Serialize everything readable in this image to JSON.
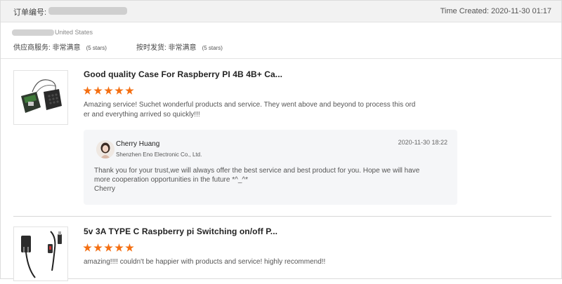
{
  "order": {
    "label": "订单编号:",
    "time_created": "Time Created: 2020-11-30 01:17"
  },
  "buyer": {
    "country": "United States",
    "ratings": [
      {
        "label": "供应商服务: 非常满意",
        "stars": "(5 stars)"
      },
      {
        "label": "按时发货: 非常满意",
        "stars": "(5 stars)"
      }
    ]
  },
  "reviews": [
    {
      "title": "Good quality Case For Raspberry PI 4B 4B+ Ca...",
      "rating": 5,
      "text_lines": [
        "Amazing service! Suchet wonderful products and service. They went above and beyond to process this ord",
        "er and everything arrived so quickly!!!"
      ],
      "reply": {
        "name": "Cherry Huang",
        "company": "Shenzhen Eno Electronic Co., Ltd.",
        "time": "2020-11-30 18:22",
        "lines": [
          "Thank you for your trust,we will always offer the best service and best product for you. Hope we will have",
          "more cooperation opportunities in the future *^_^*",
          "Cherry"
        ]
      }
    },
    {
      "title": "5v 3A TYPE C Raspberry pi Switching on/off P...",
      "rating": 5,
      "text_lines": [
        "amazing!!!! couldn't be happier with products and service! highly recommend!!"
      ]
    }
  ],
  "colors": {
    "star": "#f46f12",
    "header_bg": "#f2f2f2",
    "reply_bg": "#f5f6f8"
  }
}
